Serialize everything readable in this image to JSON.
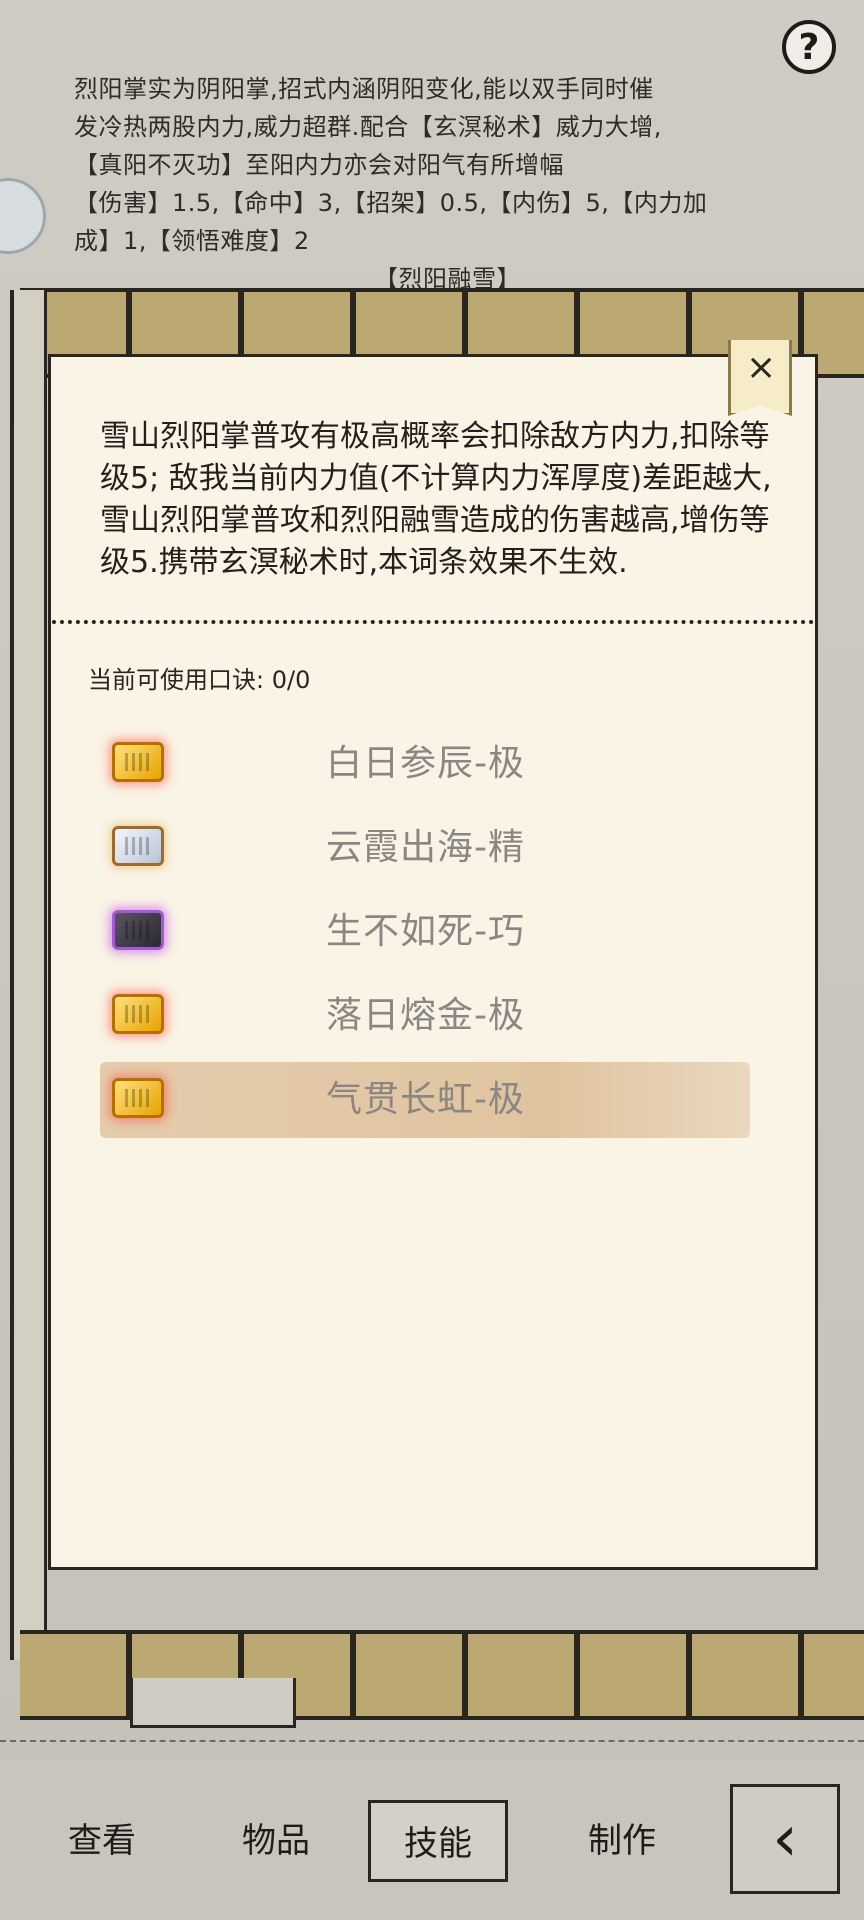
{
  "help": {
    "label": "?"
  },
  "skill_description": {
    "lines": [
      "烈阳掌实为阴阳掌,招式内涵阴阳变化,能以双手同时催",
      "发冷热两股内力,威力超群.配合【玄溟秘术】威力大增,",
      "【真阳不灭功】至阳内力亦会对阳气有所增幅",
      "【伤害】1.5,【命中】3,【招架】0.5,【内伤】5,【内力加",
      "成】1,【领悟难度】2",
      "【烈阳融雪】"
    ]
  },
  "popup": {
    "close_label": "×",
    "affix_description": "雪山烈阳掌普攻有极高概率会扣除敌方内力,扣除等级5; 敌我当前内力值(不计算内力浑厚度)差距越大,雪山烈阳掌普攻和烈阳融雪造成的伤害越高,增伤等级5.携带玄溟秘术时,本词条效果不生效.",
    "available_label": "当前可使用口诀: 0/0",
    "items": [
      {
        "name": "白日参辰-极",
        "gem": "gold-gem-icon",
        "selected": false
      },
      {
        "name": "云霞出海-精",
        "gem": "silver-gem-icon",
        "selected": false
      },
      {
        "name": "生不如死-巧",
        "gem": "dark-gem-icon",
        "selected": false
      },
      {
        "name": "落日熔金-极",
        "gem": "gold-gem-icon",
        "selected": false
      },
      {
        "name": "气贯长虹-极",
        "gem": "gold-gem-icon",
        "selected": true
      }
    ]
  },
  "bottom_nav": {
    "tabs": [
      "查看",
      "物品",
      "技能",
      "制作"
    ],
    "active_tab": "技能",
    "back_icon": "back-arrow-icon"
  },
  "colors": {
    "panel": "#f9f4e6",
    "selected": "#e2c8a4",
    "item_text": "#8a8782"
  }
}
